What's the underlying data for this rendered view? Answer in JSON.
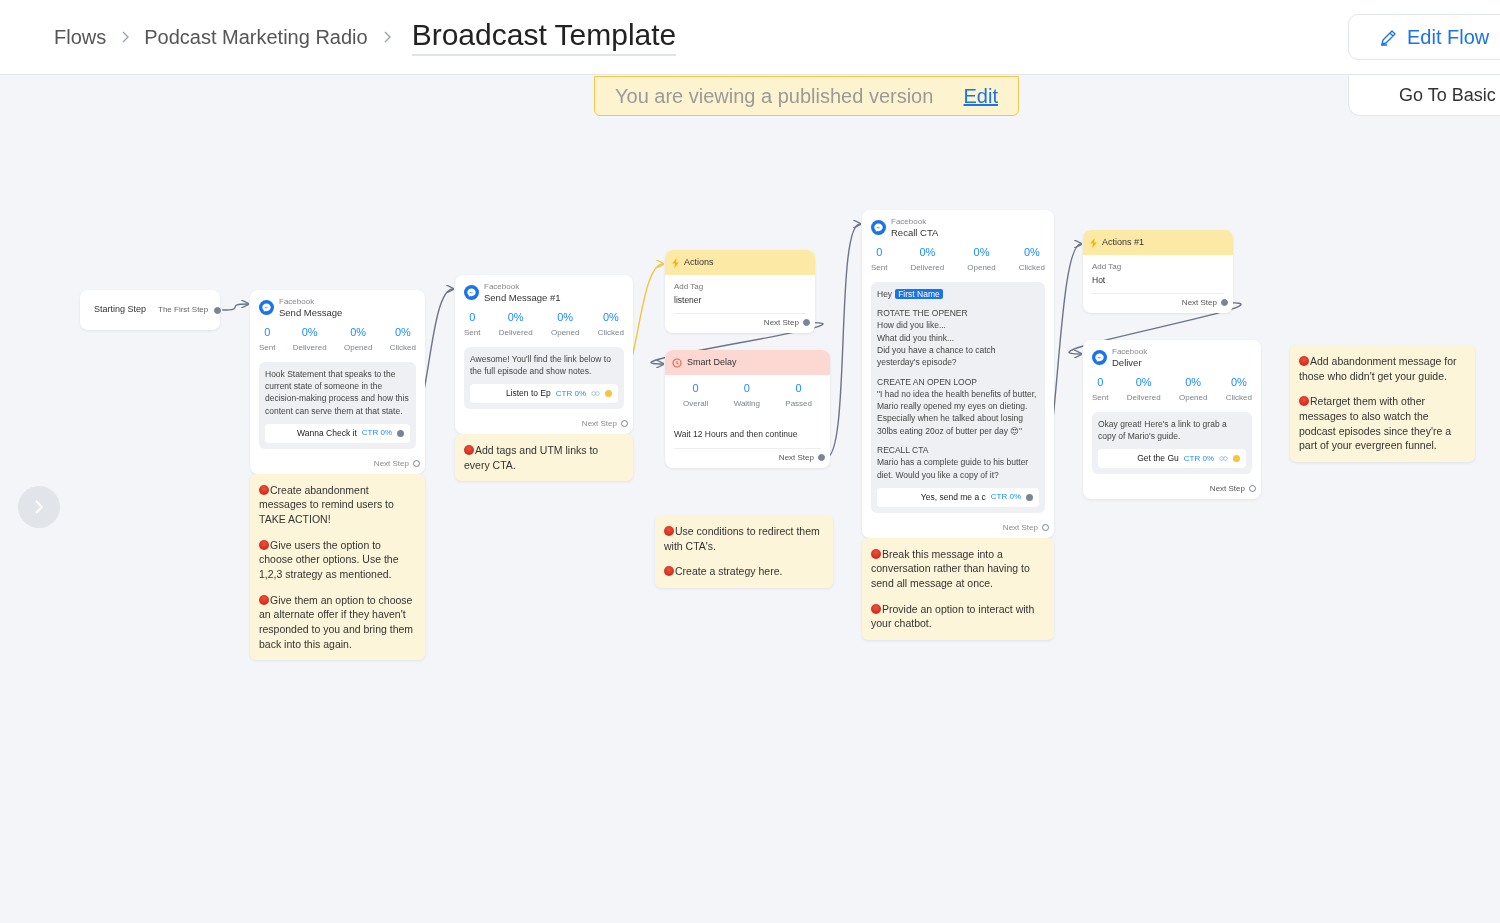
{
  "breadcrumb": [
    {
      "label": "Flows"
    },
    {
      "label": "Podcast Marketing Radio"
    }
  ],
  "title": "Broadcast Template",
  "banner": {
    "text": "You are viewing a published version",
    "link": "Edit"
  },
  "edit_flow": "Edit Flow",
  "go_to_basic": "Go To Basic",
  "nodes": [
    {
      "kind": "start",
      "title": "Starting Step",
      "out": "The First Step"
    },
    {
      "kind": "message",
      "channel": "Facebook",
      "title": "Send Message",
      "stats": [
        {
          "value": "0",
          "label": "Sent"
        },
        {
          "value": "0%",
          "label": "Delivered"
        },
        {
          "value": "0%",
          "label": "Opened"
        },
        {
          "value": "0%",
          "label": "Clicked"
        }
      ],
      "paragraphs": [
        "Hook Statement that speaks to the current state of someone in the decision-making process and how this content can serve them at that state."
      ],
      "button": {
        "label": "Wanna Check it",
        "ctr": "CTR 0%",
        "has_link": false
      },
      "next": "Next Step",
      "note": [
        "Create abandonment messages to remind users to TAKE ACTION!",
        "Give users the option to choose other options. Use the 1,2,3 strategy as mentioned.",
        "Give them an option to choose an alternate offer if they haven't responded to you and bring them back into this again."
      ]
    },
    {
      "kind": "message",
      "channel": "Facebook",
      "title": "Send Message #1",
      "stats": [
        {
          "value": "0",
          "label": "Sent"
        },
        {
          "value": "0%",
          "label": "Delivered"
        },
        {
          "value": "0%",
          "label": "Opened"
        },
        {
          "value": "0%",
          "label": "Clicked"
        }
      ],
      "paragraphs": [
        "Awesome! You'll find the link below to the full episode and show notes."
      ],
      "button": {
        "label": "Listen to Ep",
        "ctr": "CTR 0%",
        "has_link": true
      },
      "next": "Next Step",
      "note": [
        "Add tags and UTM links to every CTA."
      ]
    },
    {
      "kind": "action",
      "title": "Actions",
      "field": "Add Tag",
      "value": "listener",
      "next": "Next Step"
    },
    {
      "kind": "delay",
      "title": "Smart Delay",
      "stats": [
        {
          "value": "0",
          "label": "Overall"
        },
        {
          "value": "0",
          "label": "Waiting"
        },
        {
          "value": "0",
          "label": "Passed"
        }
      ],
      "text": "Wait 12 Hours and then continue",
      "next": "Next Step"
    },
    {
      "kind": "note",
      "paragraphs": [
        "Use conditions to redirect them with CTA's.",
        "Create a strategy here."
      ]
    },
    {
      "kind": "message",
      "channel": "Facebook",
      "title": "Recall CTA",
      "stats": [
        {
          "value": "0",
          "label": "Sent"
        },
        {
          "value": "0%",
          "label": "Delivered"
        },
        {
          "value": "0%",
          "label": "Opened"
        },
        {
          "value": "0%",
          "label": "Clicked"
        }
      ],
      "greeting": "Hey",
      "tag": "First Name",
      "paragraphs": [
        "ROTATE THE OPENER\nHow did you like...\nWhat did you think...\nDid you have a chance to catch yesterday's episode?",
        "CREATE AN OPEN LOOP\n\"I had no idea the health benefits of butter, Mario really opened my eyes on dieting. Especially when he talked about losing 30lbs eating 20oz of butter per day 😍\"",
        "RECALL CTA\nMario has a complete guide to his butter diet. Would you like a copy of it?"
      ],
      "button": {
        "label": "Yes, send me a c",
        "ctr": "CTR 0%",
        "has_link": false
      },
      "next": "Next Step",
      "note": [
        "Break this message into a conversation rather than having to send all message at once.",
        "Provide an option to interact with your chatbot."
      ]
    },
    {
      "kind": "action",
      "title": "Actions #1",
      "field": "Add Tag",
      "value": "Hot",
      "next": "Next Step"
    },
    {
      "kind": "message",
      "channel": "Facebook",
      "title": "Deliver",
      "stats": [
        {
          "value": "0",
          "label": "Sent"
        },
        {
          "value": "0%",
          "label": "Delivered"
        },
        {
          "value": "0%",
          "label": "Opened"
        },
        {
          "value": "0%",
          "label": "Clicked"
        }
      ],
      "paragraphs": [
        "Okay great! Here's a link to grab a copy of Mario's guide."
      ],
      "button": {
        "label": "Get the Gu",
        "ctr": "CTR 0%",
        "has_link": true
      },
      "next": "Next Step"
    },
    {
      "kind": "note",
      "paragraphs": [
        "Add abandonment message for those who didn't get your guide.",
        "Retarget them with other messages to also watch the podcast episodes since they're a part of your evergreen funnel."
      ]
    }
  ]
}
